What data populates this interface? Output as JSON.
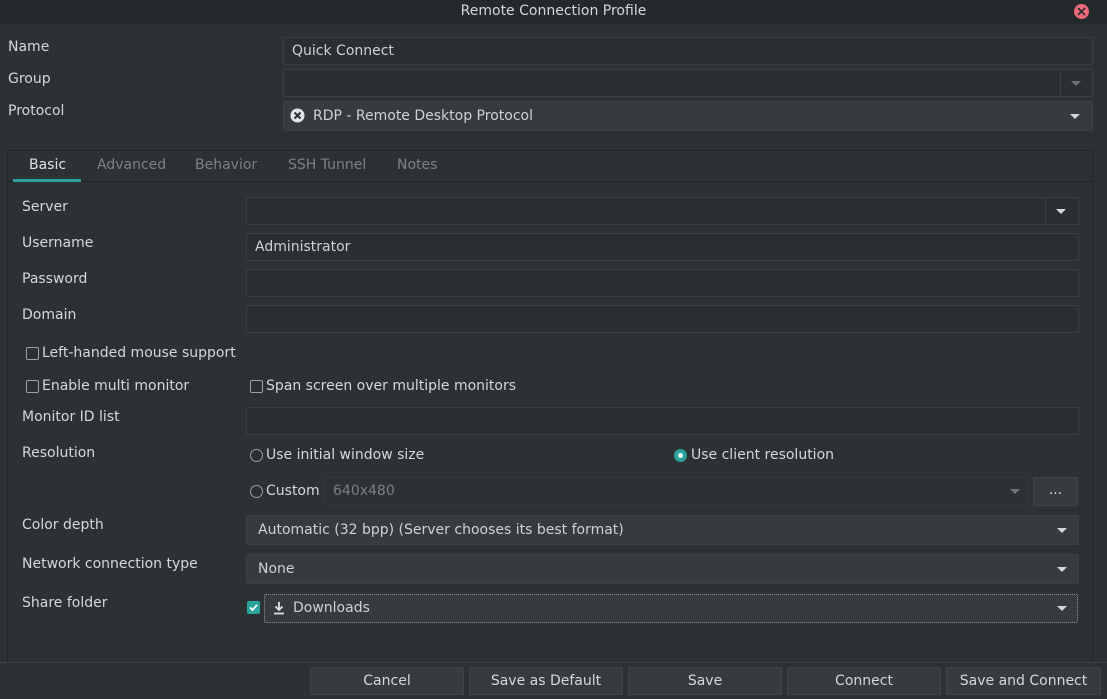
{
  "window": {
    "title": "Remote Connection Profile",
    "close_icon": "close-icon"
  },
  "profile": {
    "name_label": "Name",
    "name_value": "Quick Connect",
    "group_label": "Group",
    "group_value": "",
    "protocol_label": "Protocol",
    "protocol_value": "RDP - Remote Desktop Protocol"
  },
  "tabs": [
    "Basic",
    "Advanced",
    "Behavior",
    "SSH Tunnel",
    "Notes"
  ],
  "active_tab": "Basic",
  "basic": {
    "server_label": "Server",
    "server_value": "",
    "username_label": "Username",
    "username_value": "Administrator",
    "password_label": "Password",
    "password_value": "",
    "domain_label": "Domain",
    "domain_value": "",
    "left_handed_label": "Left-handed mouse support",
    "left_handed_checked": false,
    "multi_monitor_label": "Enable multi monitor",
    "multi_monitor_checked": false,
    "span_screen_label": "Span screen over multiple monitors",
    "span_screen_checked": false,
    "monitor_id_label": "Monitor ID list",
    "monitor_id_value": "",
    "resolution_label": "Resolution",
    "res_initial_label": "Use initial window size",
    "res_client_label": "Use client resolution",
    "res_custom_label": "Custom",
    "res_custom_value": "640x480",
    "res_selected": "Use client resolution",
    "res_more_label": "...",
    "color_depth_label": "Color depth",
    "color_depth_value": "Automatic (32 bpp) (Server chooses its best format)",
    "network_label": "Network connection type",
    "network_value": "None",
    "share_folder_label": "Share folder",
    "share_folder_checked": true,
    "share_folder_value": "Downloads"
  },
  "buttons": {
    "cancel": "Cancel",
    "save_default": "Save as Default",
    "save": "Save",
    "connect": "Connect",
    "save_connect": "Save and Connect"
  },
  "colors": {
    "accent": "#2aa39c",
    "close": "#ef6a7a",
    "background": "#2c3134"
  }
}
